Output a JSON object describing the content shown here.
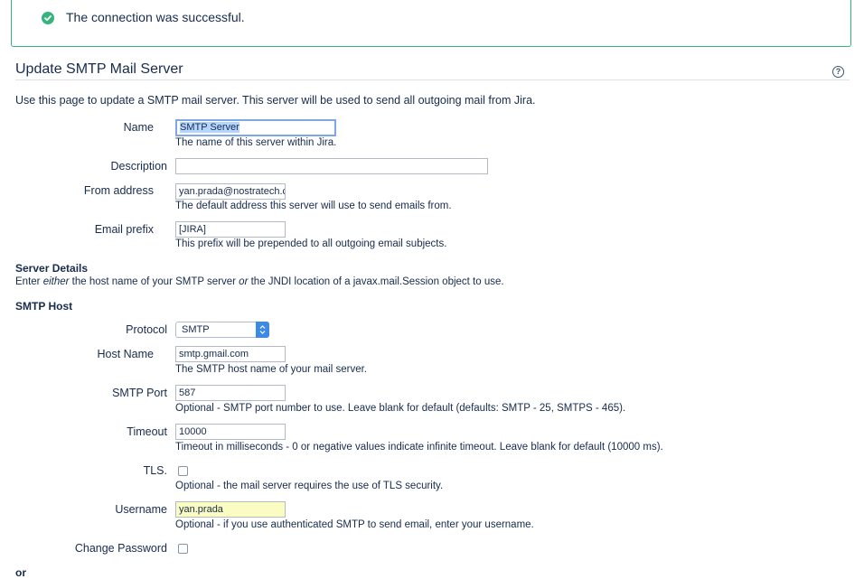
{
  "banner": {
    "message": "The connection was successful.",
    "icon": "check-circle-icon",
    "color": "#36b37e"
  },
  "page": {
    "title": "Update SMTP Mail Server",
    "intro": "Use this page to update a SMTP mail server. This server will be used to send all outgoing mail from Jira."
  },
  "fields": {
    "name": {
      "label": "Name",
      "value": "SMTP Server",
      "description": "The name of this server within Jira."
    },
    "description": {
      "label": "Description",
      "value": ""
    },
    "from_address": {
      "label": "From address",
      "value": "yan.prada@nostratech.c",
      "description": "The default address this server will use to send emails from."
    },
    "email_prefix": {
      "label": "Email prefix",
      "value": "[JIRA]",
      "description": "This prefix will be prepended to all outgoing email subjects."
    }
  },
  "server_details": {
    "heading": "Server Details",
    "sub_pre": "Enter ",
    "sub_em1": "either",
    "sub_mid": " the host name of your SMTP server ",
    "sub_em2": "or",
    "sub_post": " the JNDI location of a javax.mail.Session object to use."
  },
  "smtp_host": {
    "heading": "SMTP Host",
    "protocol": {
      "label": "Protocol",
      "value": "SMTP"
    },
    "host_name": {
      "label": "Host Name",
      "value": "smtp.gmail.com",
      "description": "The SMTP host name of your mail server."
    },
    "port": {
      "label": "SMTP Port",
      "value": "587",
      "description": "Optional - SMTP port number to use. Leave blank for default (defaults: SMTP - 25, SMTPS - 465)."
    },
    "timeout": {
      "label": "Timeout",
      "value": "10000",
      "description": "Timeout in milliseconds - 0 or negative values indicate infinite timeout. Leave blank for default (10000 ms)."
    },
    "tls": {
      "label": "TLS.",
      "checked": false,
      "description": "Optional - the mail server requires the use of TLS security."
    },
    "username": {
      "label": "Username",
      "value": "yan.prada",
      "description": "Optional - if you use authenticated SMTP to send email, enter your username."
    },
    "change_password": {
      "label": "Change Password",
      "checked": false
    }
  },
  "or_label": "or"
}
